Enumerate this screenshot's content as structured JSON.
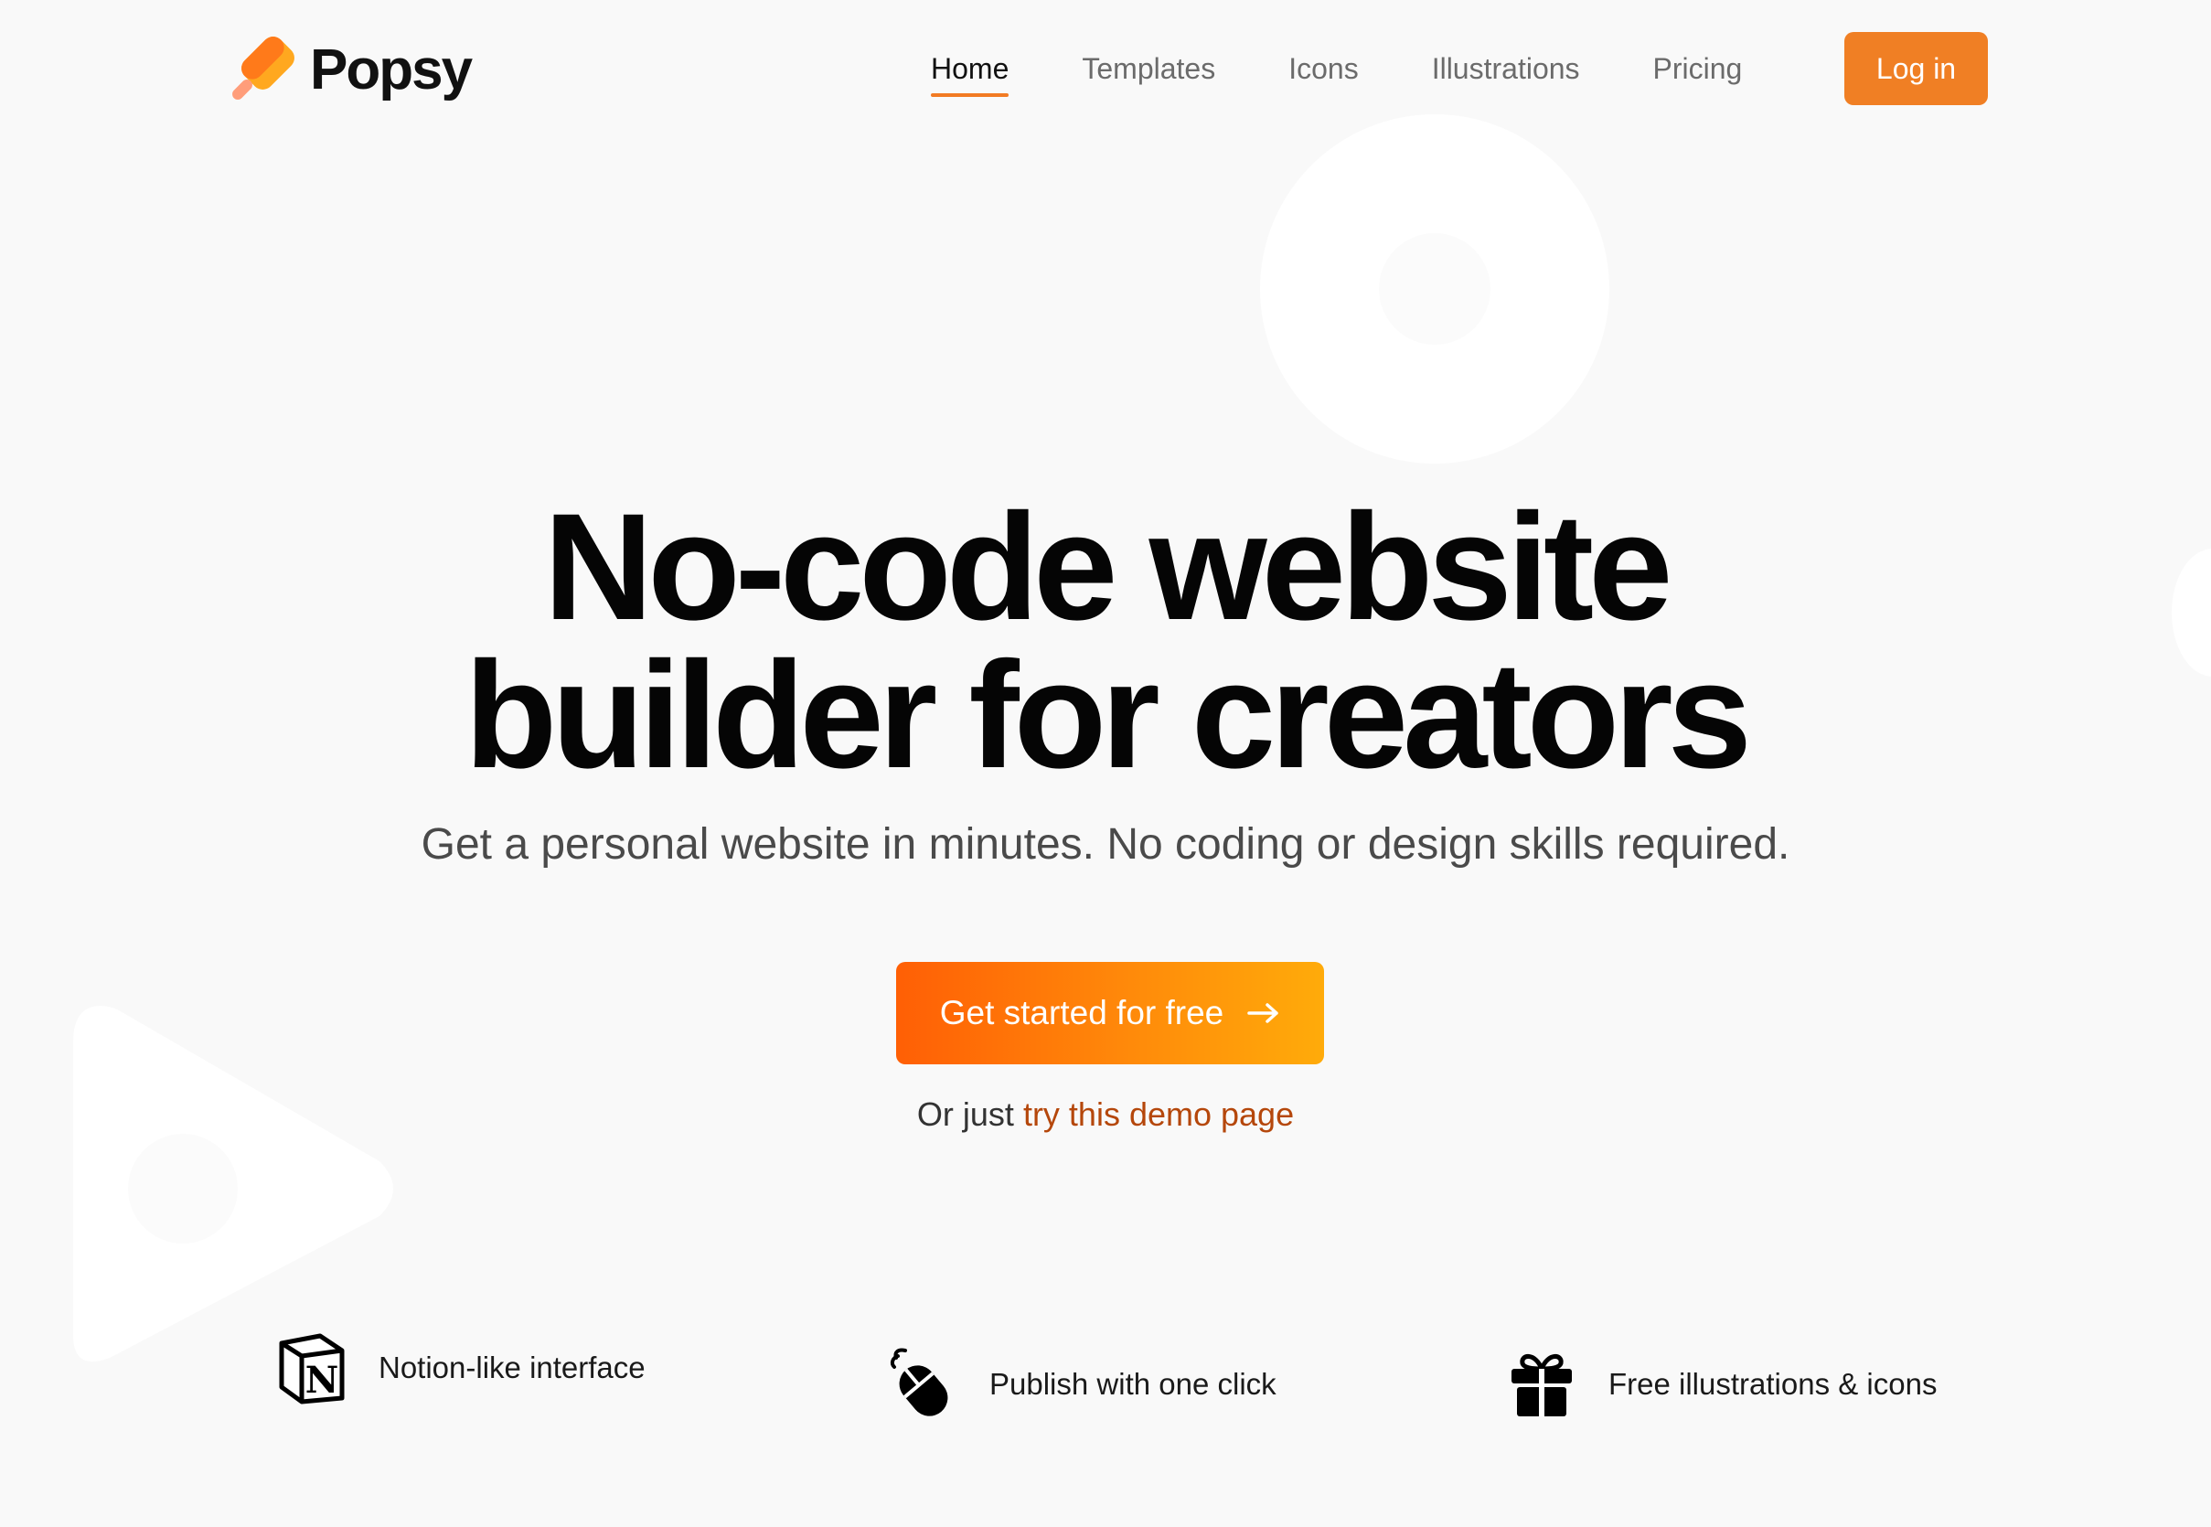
{
  "brand": {
    "name": "Popsy",
    "colors": {
      "accent": "#f07f24",
      "gradient_start": "#ff5f05",
      "gradient_end": "#ffab0a",
      "link": "#b5470b"
    }
  },
  "nav": {
    "items": [
      {
        "label": "Home",
        "active": true
      },
      {
        "label": "Templates",
        "active": false
      },
      {
        "label": "Icons",
        "active": false
      },
      {
        "label": "Illustrations",
        "active": false
      },
      {
        "label": "Pricing",
        "active": false
      }
    ],
    "login_label": "Log in"
  },
  "hero": {
    "title_line1": "No-code website",
    "title_line2": "builder for creators",
    "subtitle": "Get a personal website in minutes. No coding or design skills required.",
    "cta_label": "Get started for free",
    "cta_icon": "arrow-right-icon",
    "demo_prefix": "Or just",
    "demo_link": "try this demo page"
  },
  "features": [
    {
      "icon": "notion-icon",
      "label": "Notion-like interface"
    },
    {
      "icon": "mouse-click-icon",
      "label": "Publish with one click"
    },
    {
      "icon": "gift-icon",
      "label": "Free illustrations & icons"
    }
  ]
}
